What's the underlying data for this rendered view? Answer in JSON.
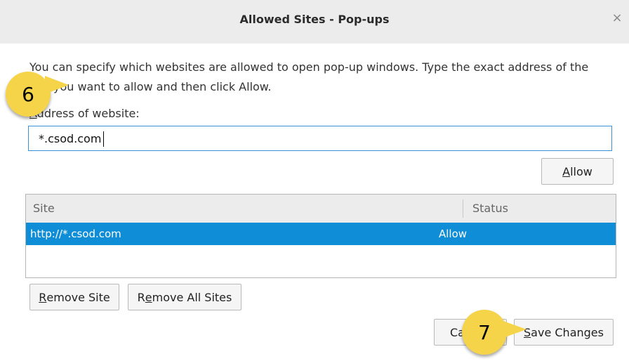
{
  "window": {
    "title": "Allowed Sites - Pop-ups",
    "close_glyph": "×"
  },
  "description": "You can specify which websites are allowed to open pop-up windows. Type the exact address of the site you want to allow and then click Allow.",
  "address": {
    "label": "Address of website:",
    "value": "*.csod.com"
  },
  "buttons": {
    "allow": "Allow",
    "remove_site": "Remove Site",
    "remove_all_sites": "Remove All Sites",
    "cancel": "Cancel",
    "save_changes": "Save Changes"
  },
  "table": {
    "columns": [
      "Site",
      "Status"
    ],
    "rows": [
      {
        "site": "http://*.csod.com",
        "status": "Allow"
      }
    ],
    "selected_row_color": "#0f8dd6"
  },
  "callouts": [
    "6",
    "7"
  ],
  "colors": {
    "callout": "#f5d44a",
    "input_focus_border": "#3d8fd6",
    "titlebar": "#ececec"
  }
}
